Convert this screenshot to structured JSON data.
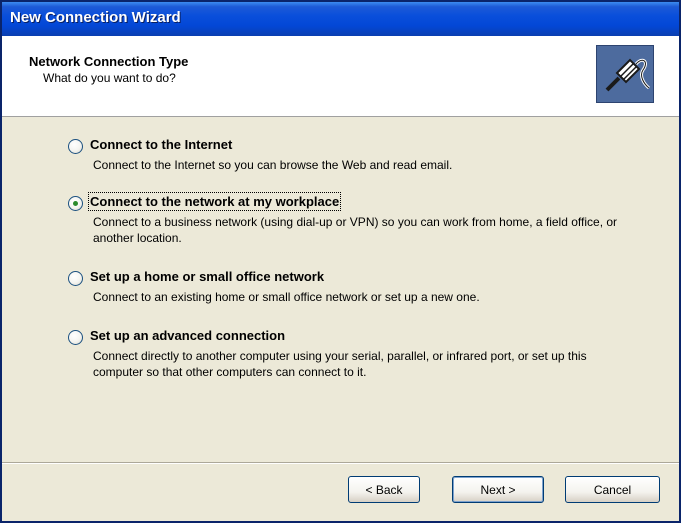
{
  "window": {
    "title": "New Connection Wizard"
  },
  "header": {
    "title": "Network Connection Type",
    "subtitle": "What do you want to do?",
    "icon": "network-cable-icon"
  },
  "options": [
    {
      "label": "Connect to the Internet",
      "description": "Connect to the Internet so you can browse the Web and read email.",
      "selected": false
    },
    {
      "label": "Connect to the network at my workplace",
      "description": "Connect to a business network (using dial-up or VPN) so you can work from home, a field office, or another location.",
      "selected": true
    },
    {
      "label": "Set up a home or small office network",
      "description": "Connect to an existing home or small office network or set up a new one.",
      "selected": false
    },
    {
      "label": "Set up an advanced connection",
      "description": "Connect directly to another computer using your serial, parallel, or infrared port, or set up this computer so that other computers can connect to it.",
      "selected": false
    }
  ],
  "buttons": {
    "back": "< Back",
    "next": "Next >",
    "cancel": "Cancel"
  },
  "colors": {
    "titlebar": "#0a4fdb",
    "dialog_background": "#ece9d8",
    "radio_selected": "#2a8a2a"
  }
}
